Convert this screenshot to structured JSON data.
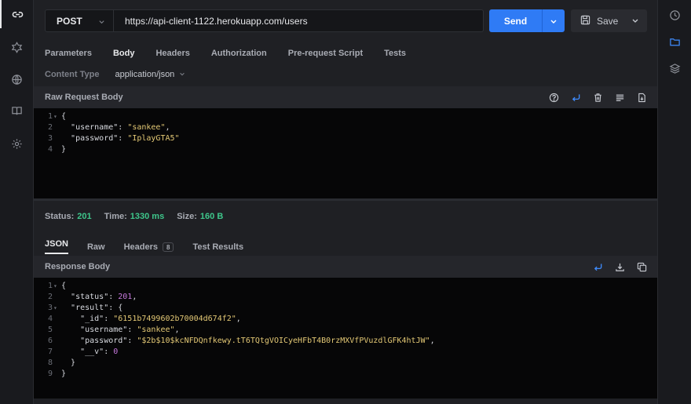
{
  "request": {
    "method": "POST",
    "url": "https://api-client-1122.herokuapp.com/users",
    "send_label": "Send",
    "save_label": "Save",
    "tabs": [
      "Parameters",
      "Body",
      "Headers",
      "Authorization",
      "Pre-request Script",
      "Tests"
    ],
    "active_tab": "Body",
    "content_type_label": "Content Type",
    "content_type_value": "application/json",
    "raw_body_title": "Raw Request Body",
    "body_lines": [
      {
        "n": "1",
        "fold": "▾",
        "text": "{"
      },
      {
        "n": "2",
        "fold": "",
        "key": "\"username\"",
        "val": "\"sankee\"",
        "tail": ","
      },
      {
        "n": "3",
        "fold": "",
        "key": "\"password\"",
        "val": "\"IplayGTA5\"",
        "tail": ""
      },
      {
        "n": "4",
        "fold": "",
        "text": "}"
      }
    ]
  },
  "response": {
    "status_label": "Status:",
    "status_value": "201",
    "time_label": "Time:",
    "time_value": "1330 ms",
    "size_label": "Size:",
    "size_value": "160 B",
    "tabs": [
      "JSON",
      "Raw",
      "Headers",
      "Test Results"
    ],
    "headers_count": "8",
    "active_tab": "JSON",
    "body_title": "Response Body",
    "body_lines": [
      {
        "n": "1",
        "fold": "▾",
        "indent": "",
        "text": "{"
      },
      {
        "n": "2",
        "fold": "",
        "indent": "  ",
        "key": "\"status\"",
        "val": "201",
        "valtype": "num",
        "tail": ","
      },
      {
        "n": "3",
        "fold": "▾",
        "indent": "  ",
        "key": "\"result\"",
        "text2": "{"
      },
      {
        "n": "4",
        "fold": "",
        "indent": "    ",
        "key": "\"_id\"",
        "val": "\"6151b7499602b70004d674f2\"",
        "valtype": "str",
        "tail": ","
      },
      {
        "n": "5",
        "fold": "",
        "indent": "    ",
        "key": "\"username\"",
        "val": "\"sankee\"",
        "valtype": "str",
        "tail": ","
      },
      {
        "n": "6",
        "fold": "",
        "indent": "    ",
        "key": "\"password\"",
        "val": "\"$2b$10$kcNFDQnfkewy.tT6TQtgVOICyeHFbT4B0rzMXVfPVuzdlGFK4htJW\"",
        "valtype": "str",
        "tail": ","
      },
      {
        "n": "7",
        "fold": "",
        "indent": "    ",
        "key": "\"__v\"",
        "val": "0",
        "valtype": "num",
        "tail": ""
      },
      {
        "n": "8",
        "fold": "",
        "indent": "  ",
        "text": "}"
      },
      {
        "n": "9",
        "fold": "",
        "indent": "",
        "text": "}"
      }
    ]
  },
  "colors": {
    "accent": "#2f7bf5",
    "status_ok": "#3ec68b",
    "string": "#e3c875",
    "number": "#c678dd"
  }
}
